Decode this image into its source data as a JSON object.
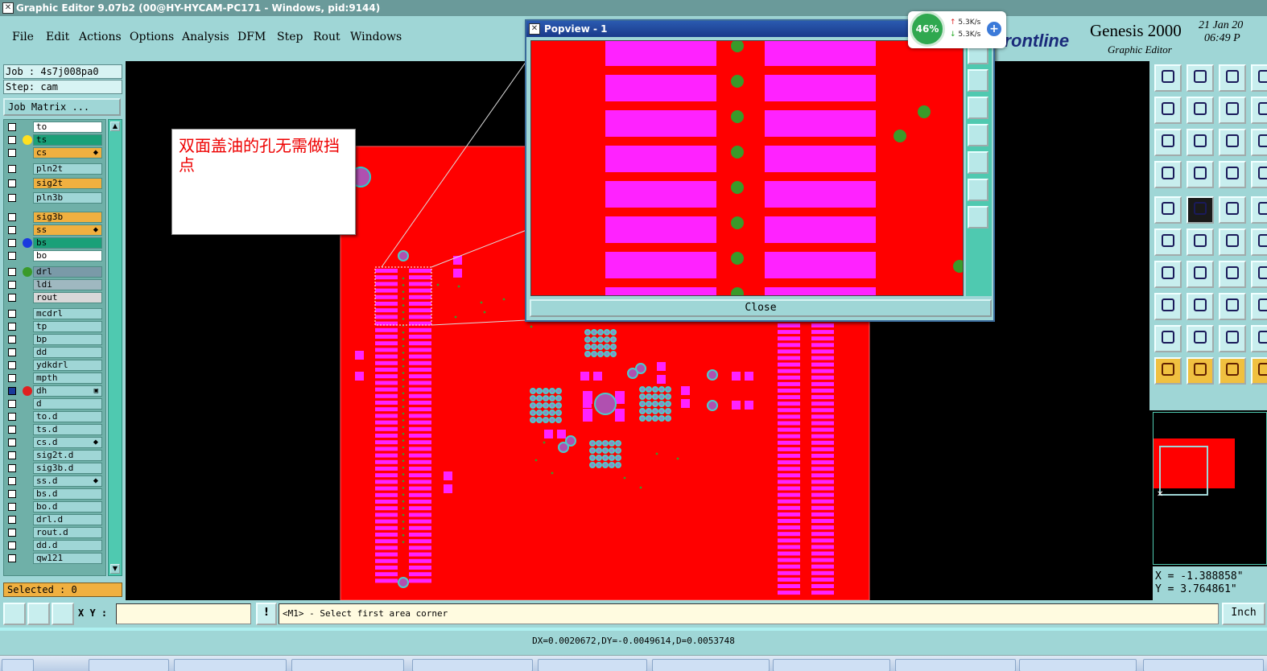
{
  "window": {
    "title": "Graphic Editor 9.07b2 (00@HY-HYCAM-PC171 - Windows, pid:9144)"
  },
  "menu": {
    "items": [
      "File",
      "Edit",
      "Actions",
      "Options",
      "Analysis",
      "DFM",
      "Step",
      "Rout",
      "Windows"
    ]
  },
  "brand": {
    "logo": "Frontline",
    "product": "Genesis 2000",
    "subtitle": "Graphic Editor",
    "date": "21 Jan 20",
    "time": "06:49 P"
  },
  "net_widget": {
    "percent": "46%",
    "upload": "5.3K/s",
    "download": "5.3K/s"
  },
  "job": {
    "job_label": "Job : 4s7j008pa0",
    "step_label": "Step: cam",
    "matrix_button": "Job Matrix ..."
  },
  "layers": [
    {
      "name": "to",
      "color": "#ffffff",
      "dot": ""
    },
    {
      "name": "ts",
      "color": "#1aa078",
      "dot": "#ffe020"
    },
    {
      "name": "cs",
      "color": "#f0b040",
      "dot": "",
      "mark": "⬥"
    },
    {
      "name": "pln2t",
      "color": "#9fd6d6",
      "dot": ""
    },
    {
      "name": "sig2t",
      "color": "#f0b040",
      "dot": ""
    },
    {
      "name": "pln3b",
      "color": "#9fd6d6",
      "dot": ""
    },
    {
      "name": "sig3b",
      "color": "#f0b040",
      "dot": ""
    },
    {
      "name": "ss",
      "color": "#f0b040",
      "dot": "",
      "mark": "⬥"
    },
    {
      "name": "bs",
      "color": "#1aa078",
      "dot": "#1a3adf"
    },
    {
      "name": "bo",
      "color": "#ffffff",
      "dot": ""
    },
    {
      "name": "drl",
      "color": "#7a9aa8",
      "dot": "#3a9a2a"
    },
    {
      "name": "ldi",
      "color": "#9fb8c0",
      "dot": ""
    },
    {
      "name": "rout",
      "color": "#d8d8d8",
      "dot": ""
    },
    {
      "name": "mcdrl",
      "color": "#9fd6d6",
      "dot": ""
    },
    {
      "name": "tp",
      "color": "#9fd6d6",
      "dot": ""
    },
    {
      "name": "bp",
      "color": "#9fd6d6",
      "dot": ""
    },
    {
      "name": "dd",
      "color": "#9fd6d6",
      "dot": ""
    },
    {
      "name": "ydkdrl",
      "color": "#9fd6d6",
      "dot": ""
    },
    {
      "name": "mpth",
      "color": "#9fd6d6",
      "dot": ""
    },
    {
      "name": "dh",
      "color": "#9fd6d6",
      "dot": "#e02020",
      "mark": "▣",
      "checked": true
    },
    {
      "name": "d",
      "color": "#9fd6d6",
      "dot": ""
    },
    {
      "name": "to.d",
      "color": "#9fd6d6",
      "dot": ""
    },
    {
      "name": "ts.d",
      "color": "#9fd6d6",
      "dot": ""
    },
    {
      "name": "cs.d",
      "color": "#9fd6d6",
      "dot": "",
      "mark": "⬥"
    },
    {
      "name": "sig2t.d",
      "color": "#9fd6d6",
      "dot": ""
    },
    {
      "name": "sig3b.d",
      "color": "#9fd6d6",
      "dot": ""
    },
    {
      "name": "ss.d",
      "color": "#9fd6d6",
      "dot": "",
      "mark": "⬥"
    },
    {
      "name": "bs.d",
      "color": "#9fd6d6",
      "dot": ""
    },
    {
      "name": "bo.d",
      "color": "#9fd6d6",
      "dot": ""
    },
    {
      "name": "drl.d",
      "color": "#9fd6d6",
      "dot": ""
    },
    {
      "name": "rout.d",
      "color": "#9fd6d6",
      "dot": ""
    },
    {
      "name": "dd.d",
      "color": "#9fd6d6",
      "dot": ""
    },
    {
      "name": "qw121",
      "color": "#9fd6d6",
      "dot": ""
    }
  ],
  "selected_label": "Selected : 0",
  "annotation": {
    "text": "双面盖油的孔无需做挡点"
  },
  "popview": {
    "title": "Popview - 1",
    "close_label": "Close"
  },
  "coords": {
    "x": "X = -1.388858\"",
    "y": "Y = 3.764861\""
  },
  "bottom": {
    "xy_label": "X Y :",
    "xy_value": "",
    "alert": "!",
    "prompt": "<M1> - Select first area corner",
    "unit": "Inch"
  },
  "status": {
    "measure": "DX=0.0020672,DY=-0.0049614,D=0.0053748"
  },
  "colors": {
    "board": "#ff0000",
    "pad": "#ff22ff",
    "drill": "#3a9a2a",
    "panel": "#9fd6d6"
  }
}
